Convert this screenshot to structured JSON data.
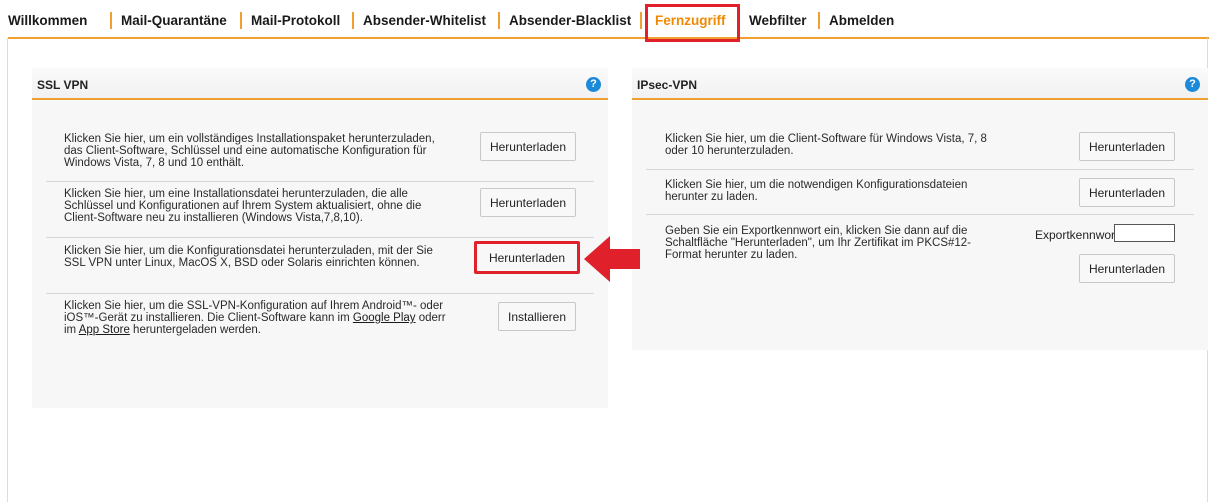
{
  "nav": {
    "items": [
      {
        "label": "Willkommen"
      },
      {
        "label": "Mail-Quarantäne"
      },
      {
        "label": "Mail-Protokoll"
      },
      {
        "label": "Absender-Whitelist"
      },
      {
        "label": "Absender-Blacklist"
      },
      {
        "label": "Fernzugriff",
        "active": true
      },
      {
        "label": "Webfilter"
      },
      {
        "label": "Abmelden"
      }
    ]
  },
  "ssl": {
    "title": "SSL VPN",
    "help": "?",
    "rows": [
      {
        "text": "Klicken Sie hier, um ein vollständiges Installationspaket herunterzuladen, das Client-Software, Schlüssel und eine automatische Konfiguration für Windows Vista, 7, 8 und 10 enthält.",
        "button": "Herunterladen"
      },
      {
        "text": "Klicken Sie hier, um eine Installationsdatei herunterzuladen, die alle Schlüssel und Konfigurationen auf Ihrem System aktualisiert, ohne die Client-Software neu zu installieren (Windows Vista,7,8,10).",
        "button": "Herunterladen"
      },
      {
        "text": "Klicken Sie hier, um die Konfigurationsdatei herunterzuladen, mit der Sie SSL VPN unter Linux, MacOS X, BSD oder Solaris einrichten können.",
        "button": "Herunterladen"
      },
      {
        "text_before": "Klicken Sie hier, um die SSL-VPN-Konfiguration auf Ihrem Android™- oder iOS™-Gerät zu installieren. Die Client-Software kann im ",
        "link1": "Google Play",
        "text_middle": " oderr im ",
        "link2": "App Store",
        "text_after": " heruntergeladen werden.",
        "button": "Installieren"
      }
    ]
  },
  "ipsec": {
    "title": "IPsec-VPN",
    "help": "?",
    "rows": [
      {
        "text": "Klicken Sie hier, um die Client-Software für Windows Vista, 7, 8 oder 10 herunterzuladen.",
        "button": "Herunterladen"
      },
      {
        "text": "Klicken Sie hier, um die notwendigen Konfigurationsdateien herunter zu laden.",
        "button": "Herunterladen"
      },
      {
        "text": "Geben Sie ein Exportkennwort ein, klicken Sie dann auf die Schaltfläche \"Herunterladen\", um Ihr Zertifikat im PKCS#12-Format herunter zu laden.",
        "export_label": "Exportkennwort:",
        "export_value": "",
        "button": "Herunterladen"
      }
    ]
  },
  "colors": {
    "accent": "#f0a030",
    "active_nav": "#f08a00",
    "highlight": "#e0202a",
    "help_icon": "#1c8ad8"
  }
}
